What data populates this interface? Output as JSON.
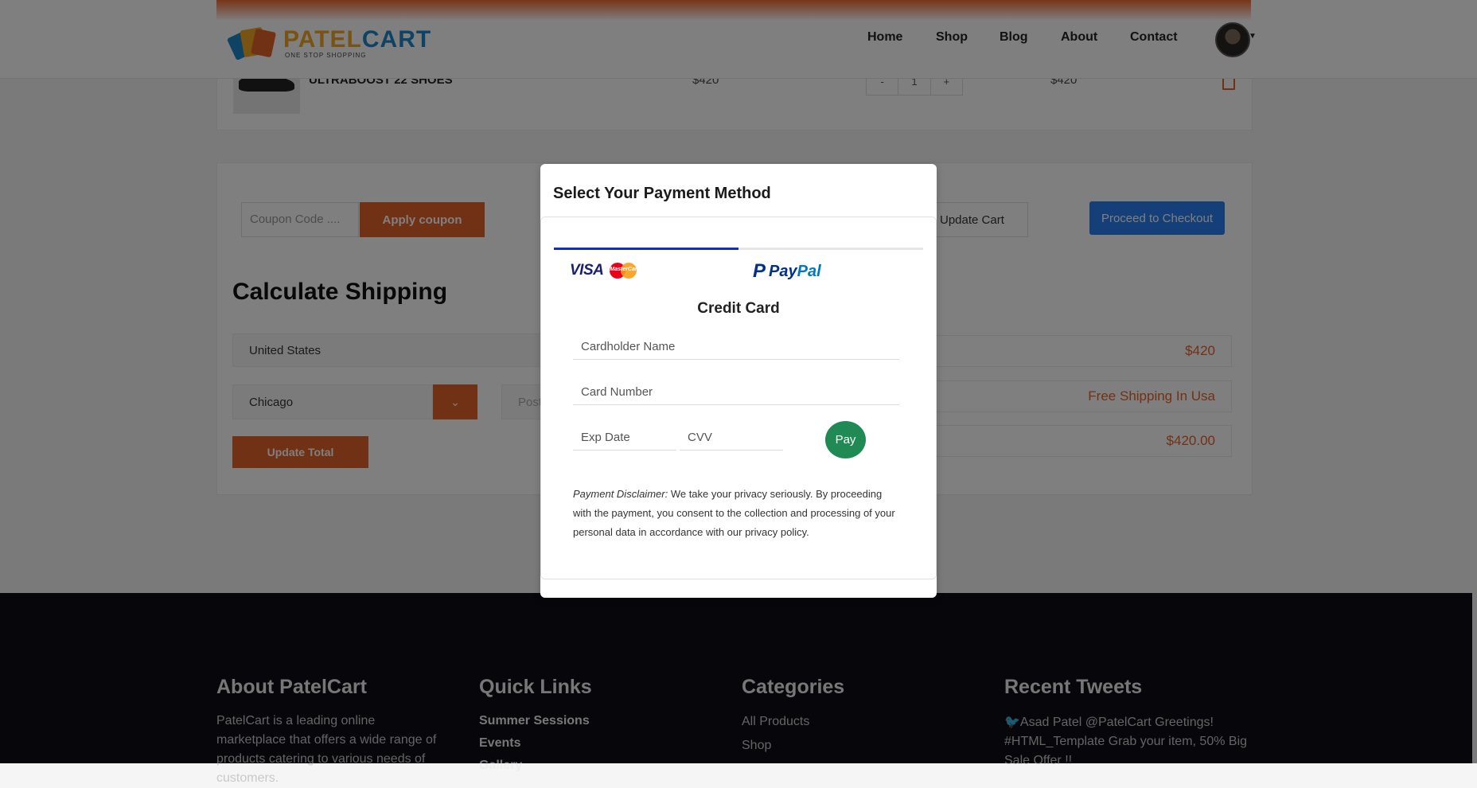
{
  "header": {
    "logo_name_a": "PATEL",
    "logo_name_b": "CART",
    "logo_tagline": "ONE STOP SHOPPING",
    "nav": [
      "Home",
      "Shop",
      "Blog",
      "About",
      "Contact"
    ]
  },
  "cart": {
    "item_name": "ULTRABOOST 22 SHOES",
    "price": "$420",
    "qty_minus": "-",
    "qty": "1",
    "qty_plus": "+",
    "subtotal": "$420"
  },
  "actions": {
    "coupon_placeholder": "Coupon Code ....",
    "apply_coupon": "Apply coupon",
    "update_cart": "Update Cart",
    "checkout": "Proceed to Checkout"
  },
  "shipping": {
    "title": "Calculate Shipping",
    "country": "United States",
    "city": "Chicago",
    "postcode_placeholder": "Post",
    "update_total": "Update Total"
  },
  "totals": {
    "subtotal": "$420",
    "shipping": "Free Shipping In Usa",
    "total": "$420.00"
  },
  "modal": {
    "title": "Select Your Payment Method",
    "tab_card_visa": "VISA",
    "tab_card_mc": "MasterCard",
    "tab_paypal_a": "Pay",
    "tab_paypal_b": "Pal",
    "heading": "Credit Card",
    "cardholder_placeholder": "Cardholder Name",
    "card_number_placeholder": "Card Number",
    "exp_placeholder": "Exp Date",
    "cvv_placeholder": "CVV",
    "pay_label": "Pay",
    "disclaimer_label": "Payment Disclaimer:",
    "disclaimer_text": " We take your privacy seriously. By proceeding with the payment, you consent to the collection and processing of your personal data in accordance with our privacy policy."
  },
  "footer": {
    "about_title": "About PatelCart",
    "about_text": "PatelCart is a leading online marketplace that offers a wide range of products catering to various needs of customers.",
    "quick_title": "Quick Links",
    "quick_links": [
      "Summer Sessions",
      "Events",
      "Gallery"
    ],
    "categories_title": "Categories",
    "categories": [
      "All Products",
      "Shop"
    ],
    "tweets_title": "Recent Tweets",
    "tweet_text": "Asad Patel @PatelCart Greetings! #HTML_Template Grab your item, 50% Big Sale Offer !!"
  },
  "colors": {
    "accent": "#e2632a",
    "checkout_blue": "#2a7ef0",
    "pay_green": "#1f8a54",
    "tab_active": "#0b2be0",
    "footer_bg": "#0f0e16"
  }
}
